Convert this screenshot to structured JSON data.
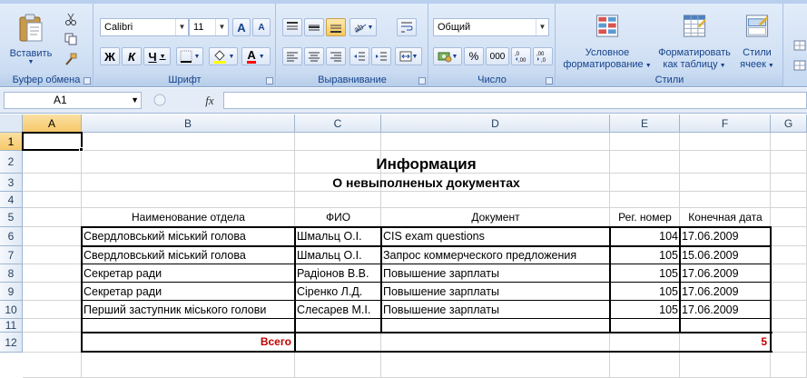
{
  "ribbon": {
    "clipboard": {
      "paste": "Вставить",
      "label": "Буфер обмена"
    },
    "font": {
      "name": "Calibri",
      "size": "11",
      "bold": "Ж",
      "italic": "К",
      "underline": "Ч",
      "grow": "A",
      "shrink": "A",
      "color_letter": "A",
      "label": "Шрифт"
    },
    "alignment": {
      "label": "Выравнивание"
    },
    "number": {
      "format": "Общий",
      "percent": "%",
      "thousands": "000",
      "label": "Число"
    },
    "styles": {
      "conditional_line1": "Условное",
      "conditional_line2": "форматирование",
      "table_line1": "Форматировать",
      "table_line2": "как таблицу",
      "cell_line1": "Стили",
      "cell_line2": "ячеек",
      "label": "Стили"
    }
  },
  "formula_bar": {
    "name_box": "A1",
    "fx": "fx",
    "value": ""
  },
  "columns": [
    "A",
    "B",
    "C",
    "D",
    "E",
    "F",
    "G"
  ],
  "rows": [
    "1",
    "2",
    "3",
    "4",
    "5",
    "6",
    "7",
    "8",
    "9",
    "10",
    "11",
    "12"
  ],
  "sheet": {
    "title": "Информация",
    "subtitle": "О невыполненых документах",
    "headers": [
      "Наименование отдела",
      "ФИО",
      "Документ",
      "Рег. номер",
      "Конечная дата"
    ],
    "records": [
      [
        "Свердловський міський голова",
        "Шмальц О.І.",
        "CIS exam questions",
        "104",
        "17.06.2009"
      ],
      [
        "Свердловський міський голова",
        "Шмальц О.І.",
        "Запрос коммерческого предложения",
        "105",
        "15.06.2009"
      ],
      [
        "Секретар ради",
        "Радіонов В.В.",
        "Повышение зарплаты",
        "105",
        "17.06.2009"
      ],
      [
        "Секретар ради",
        "Сіренко  Л.Д.",
        "Повышение зарплаты",
        "105",
        "17.06.2009"
      ],
      [
        "Перший заступник міського голови",
        "Слесарев М.І.",
        "Повышение зарплаты",
        "105",
        "17.06.2009"
      ]
    ],
    "total_label": "Всего",
    "total_value": "5",
    "total_color": "#c00000"
  }
}
